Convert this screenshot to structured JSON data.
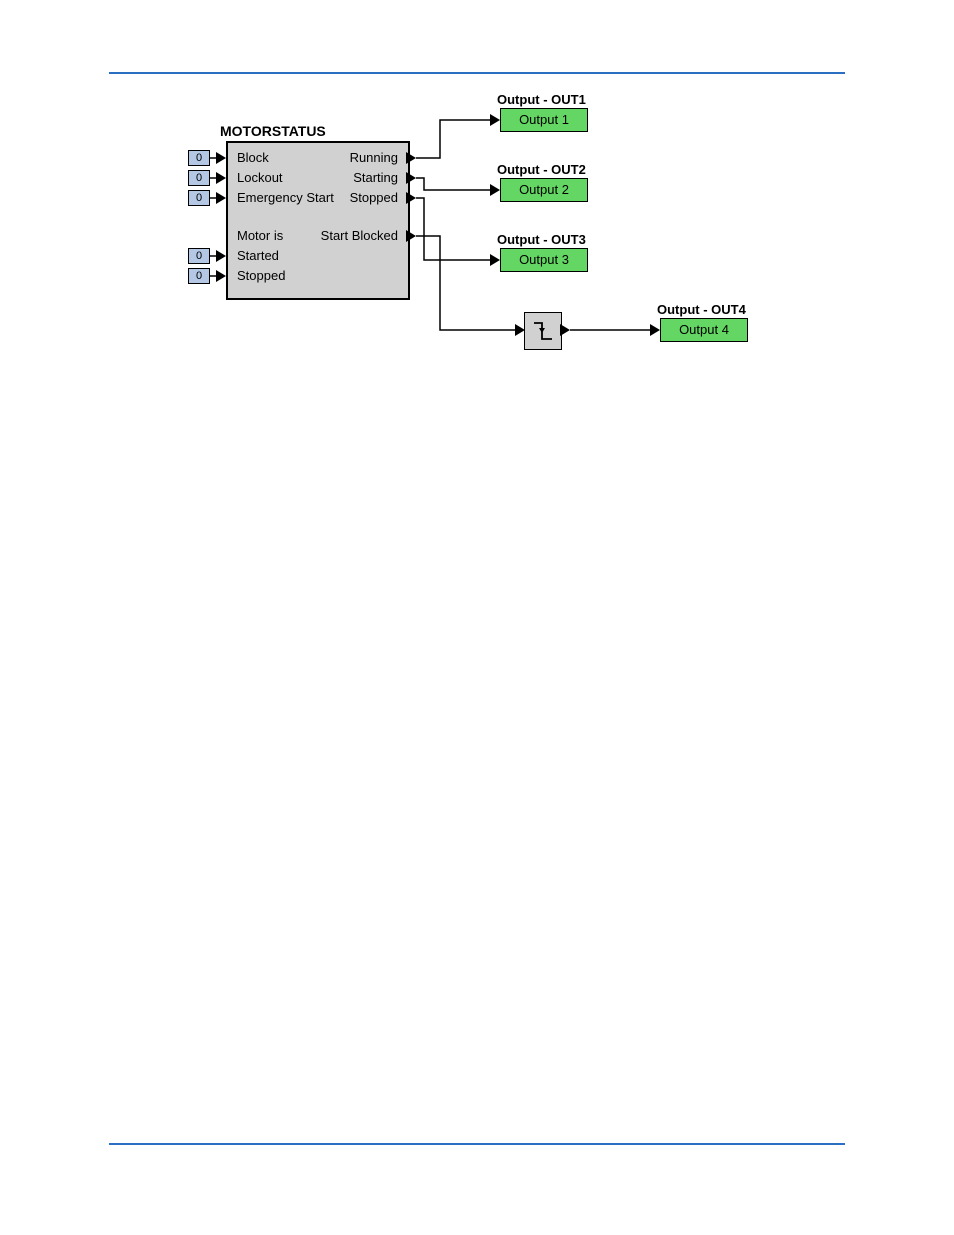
{
  "block": {
    "title": "MOTORSTATUS",
    "inputs": {
      "block": "Block",
      "lockout": "Lockout",
      "emergency": "Emergency Start",
      "motor_is": "Motor is",
      "started": "Started",
      "stopped": "Stopped"
    },
    "outputs": {
      "running": "Running",
      "starting": "Starting",
      "stopped": "Stopped",
      "start_blocked": "Start Blocked"
    }
  },
  "input_consts": {
    "block": "0",
    "lockout": "0",
    "emergency": "0",
    "started": "0",
    "stopped": "0"
  },
  "outputs": {
    "out1": {
      "title": "Output - OUT1",
      "label": "Output 1"
    },
    "out2": {
      "title": "Output - OUT2",
      "label": "Output 2"
    },
    "out3": {
      "title": "Output - OUT3",
      "label": "Output 3"
    },
    "out4": {
      "title": "Output - OUT4",
      "label": "Output 4"
    }
  }
}
